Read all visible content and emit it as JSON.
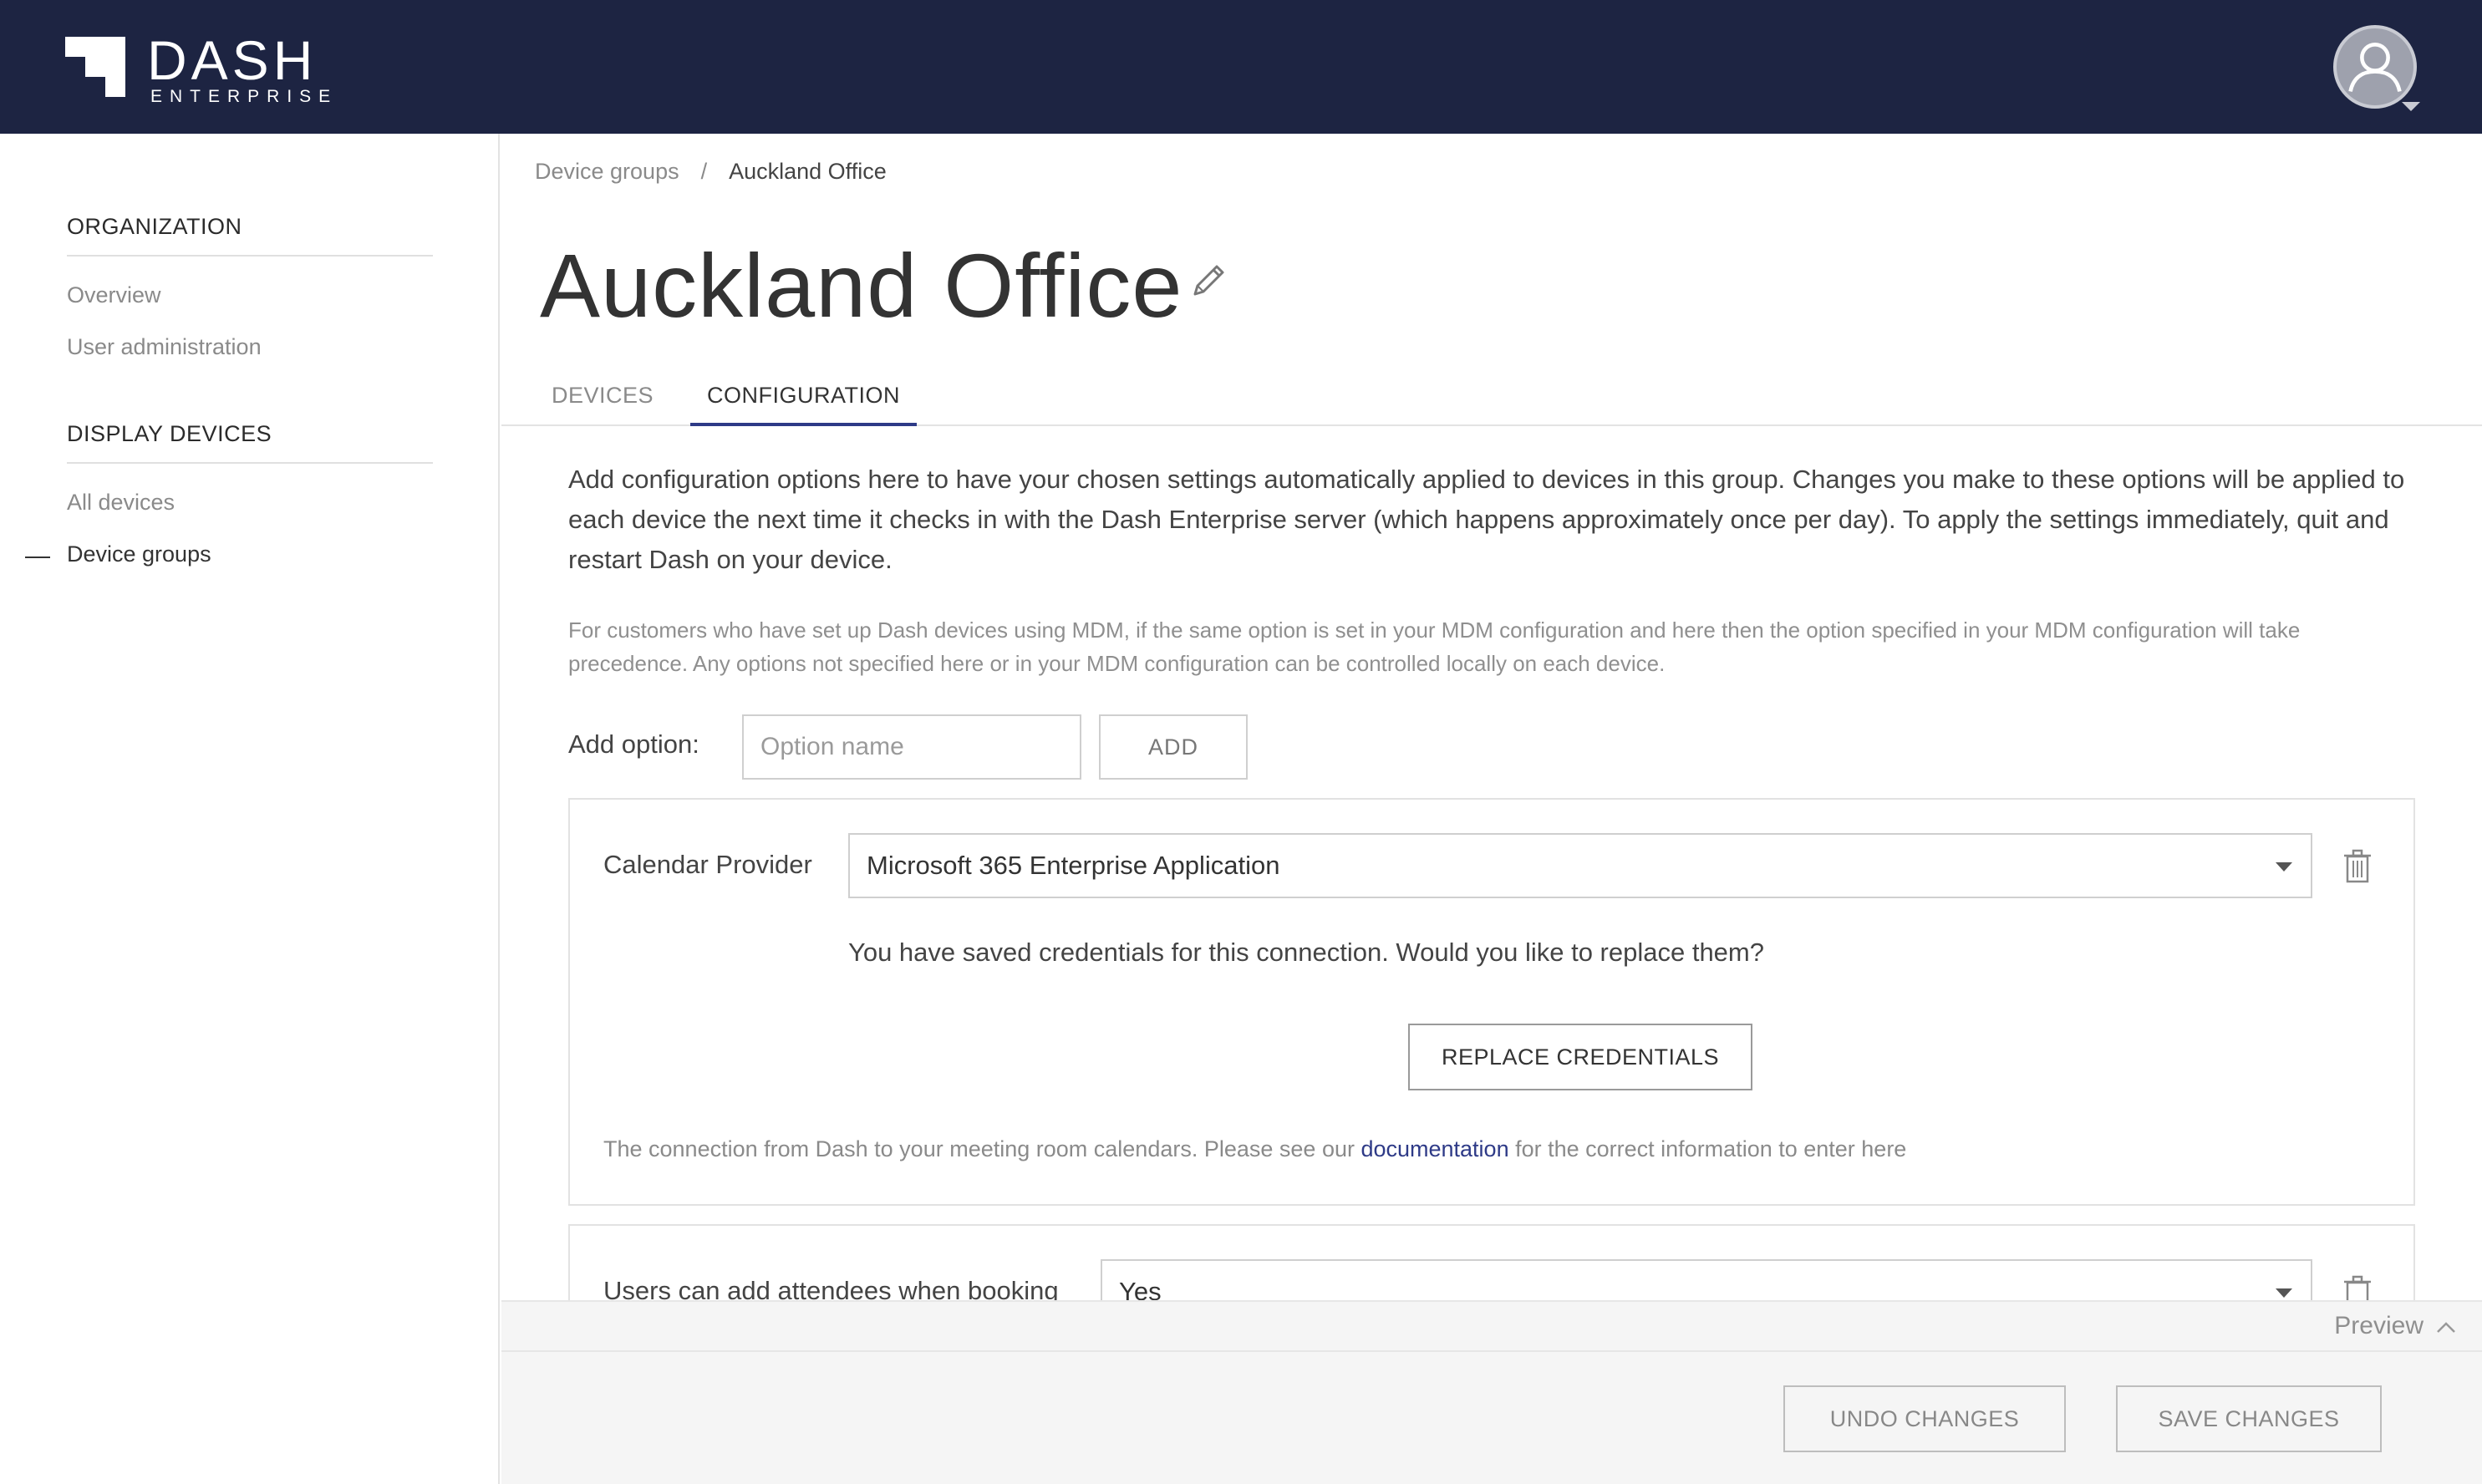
{
  "header": {
    "logo_title": "DASH",
    "logo_subtitle": "ENTERPRISE",
    "avatar_icon": "user-avatar-icon",
    "colors": {
      "bar": "#1d2442",
      "accent": "#2e3a87"
    }
  },
  "sidebar": {
    "sections": [
      {
        "title": "ORGANIZATION",
        "items": [
          {
            "label": "Overview"
          },
          {
            "label": "User administration"
          }
        ]
      },
      {
        "title": "DISPLAY DEVICES",
        "items": [
          {
            "label": "All devices"
          },
          {
            "label": "Device groups",
            "active": true
          }
        ]
      }
    ]
  },
  "breadcrumb": {
    "parent": "Device groups",
    "separator": "/",
    "current": "Auckland Office"
  },
  "page": {
    "title": "Auckland Office",
    "edit_icon": "pencil-icon"
  },
  "tabs": [
    {
      "label": "DEVICES"
    },
    {
      "label": "CONFIGURATION",
      "active": true
    }
  ],
  "intro": "Add configuration options here to have your chosen settings automatically applied to devices in this group. Changes you make to these options will be applied to each device the next time it checks in with the Dash Enterprise server (which happens approximately once per day). To apply the settings immediately, quit and restart Dash on your device.",
  "note": "For customers who have set up Dash devices using MDM, if the same option is set in your MDM configuration and here then the option specified in your MDM configuration will take precedence. Any options not specified here or in your MDM configuration can be controlled locally on each device.",
  "add_option": {
    "label": "Add option:",
    "placeholder": "Option name",
    "button": "ADD"
  },
  "options": [
    {
      "label": "Calendar Provider",
      "value": "Microsoft 365 Enterprise Application",
      "credentials_text": "You have saved credentials for this connection. Would you like to replace them?",
      "replace_button": "REPLACE CREDENTIALS",
      "help_before": "The connection from Dash to your meeting room calendars. Please see our ",
      "help_link": "documentation",
      "help_after": " for the correct information to enter here"
    },
    {
      "label": "Users can add attendees when booking",
      "value": "Yes"
    }
  ],
  "preview": {
    "label": "Preview",
    "icon": "chevron-up-icon"
  },
  "footer": {
    "undo": "UNDO CHANGES",
    "save": "SAVE CHANGES"
  }
}
